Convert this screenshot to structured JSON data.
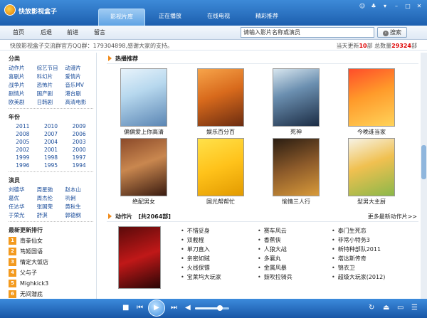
{
  "app": {
    "title": "快放影视盒子"
  },
  "tabs": [
    {
      "label": "影视片库"
    },
    {
      "label": "正在播放"
    },
    {
      "label": "在线电视"
    },
    {
      "label": "精彩推荐"
    }
  ],
  "nav": {
    "home": "首页",
    "back": "后退",
    "forward": "前进",
    "message": "留言"
  },
  "search": {
    "value": "请输入影片名称或演员",
    "button": "搜索"
  },
  "info": {
    "notice": "快放影视盒子交流群官方QQ群：179304898,感谢大家的支持。",
    "update_prefix": "当天更新",
    "update_count": "10",
    "update_mid": "部 总数量",
    "total": "29324",
    "update_suffix": "部"
  },
  "sidebar": {
    "category_title": "分类",
    "categories": [
      "动作片",
      "综艺节目",
      "动漫片",
      "喜剧片",
      "科幻片",
      "爱情片",
      "战争片",
      "恐怖片",
      "音乐MV",
      "剧情片",
      "国产剧",
      "港台剧",
      "欧美剧",
      "日韩剧",
      "高清电影"
    ],
    "year_title": "年份",
    "years": [
      "2011",
      "2010",
      "2009",
      "2008",
      "2007",
      "2006",
      "2005",
      "2004",
      "2003",
      "2002",
      "2001",
      "2000",
      "1999",
      "1998",
      "1997",
      "1996",
      "1995",
      "1994"
    ],
    "actor_title": "演员",
    "actors": [
      "刘德华",
      "周星驰",
      "赵本山",
      "葛优",
      "周杰伦",
      "巩俐",
      "任达华",
      "张国荣",
      "黄秋生",
      "于荣光",
      "舒淇",
      "郭德纲"
    ],
    "rank_title": "最新更新排行",
    "ranks": [
      {
        "no": "1",
        "name": "南拳仙女"
      },
      {
        "no": "2",
        "name": "笃姬国语"
      },
      {
        "no": "3",
        "name": "情定大饭店"
      },
      {
        "no": "4",
        "name": "父与子"
      },
      {
        "no": "5",
        "name": "Mighkick3"
      },
      {
        "no": "6",
        "name": "无间潜底"
      }
    ]
  },
  "hot": {
    "title": "热播推荐",
    "items": [
      {
        "caption": "偏偏爱上你高清"
      },
      {
        "caption": "娱乐百分百"
      },
      {
        "caption": "死神"
      },
      {
        "caption": "今晚谁当家"
      },
      {
        "caption": "绝配男女"
      },
      {
        "caption": "国光帮帮忙"
      },
      {
        "caption": "愉情三人行"
      },
      {
        "caption": "型男大主厨"
      }
    ]
  },
  "action": {
    "title": "动作片",
    "count": "[共2064部]",
    "more": "更多最新动作片>>",
    "col1": [
      "不惜妥身",
      "双截棍",
      "单刀直入",
      "亲密如贼",
      "火线保镖",
      "宝莱坞大玩家"
    ],
    "col2": [
      "赛车风云",
      "香蕉侠",
      "人狼大战",
      "多襄丸",
      "金属风暴",
      "鼓吹拉骑兵"
    ],
    "col3": [
      "泰门生死恋",
      "非常小特务3",
      "新特种部队2011",
      "塔达斯传奇",
      "锦衣卫",
      "超级大玩家(2012)"
    ]
  },
  "colors": {
    "titlebar": "#2a6fb5",
    "accent": "#f08a1a",
    "link": "#1a4c9a",
    "count": "#dd0000"
  }
}
